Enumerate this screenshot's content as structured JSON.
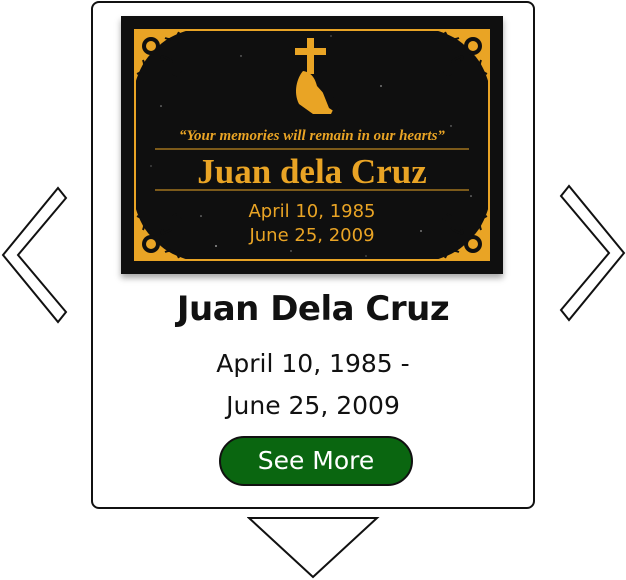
{
  "memorial": {
    "name": "Juan Dela Cruz",
    "birth_date": "April 10, 1985 -",
    "death_date": "June 25, 2009"
  },
  "plaque": {
    "quote": "“Your memories will remain in our hearts”",
    "name": "Juan dela Cruz",
    "birth_date": "April 10, 1985",
    "death_date": "June 25, 2009",
    "background_color": "#0f0f0f",
    "gold_color": "#e9a425"
  },
  "actions": {
    "see_more_label": "See More",
    "button_color": "#0a6610"
  },
  "navigation": {
    "prev_icon": "chevron-left-icon",
    "next_icon": "chevron-right-icon",
    "down_icon": "triangle-down-icon"
  }
}
